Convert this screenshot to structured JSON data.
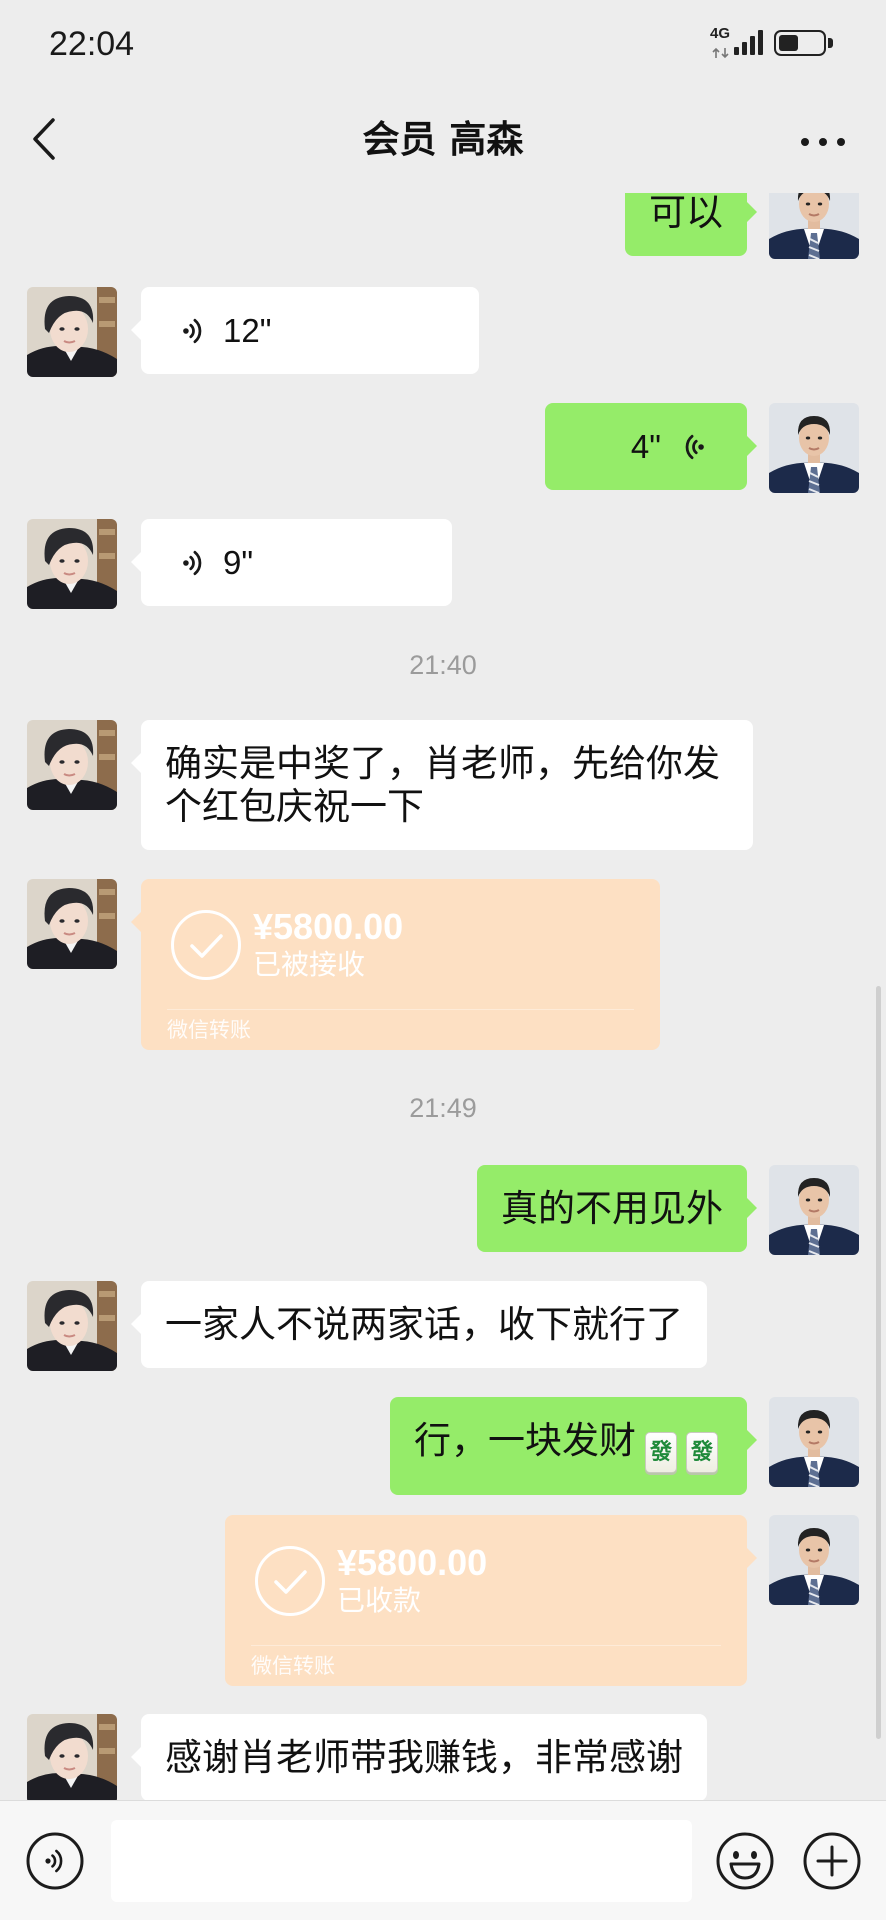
{
  "colors": {
    "background": "#ededed",
    "bubble_self": "#95ec69",
    "bubble_other": "#ffffff",
    "transfer_received": "#fde0c3",
    "timestamp_text": "#9b9b9b",
    "input_bar": "#f7f7f7"
  },
  "status_bar": {
    "time": "22:04",
    "network": "4G",
    "battery_level": 0.45,
    "signal_icon": "signal-bars-icon",
    "battery_icon": "battery-icon"
  },
  "header": {
    "title": "会员 高森",
    "back_icon": "chevron-left-icon",
    "more_icon": "more-dots-icon"
  },
  "messages": [
    {
      "outgoing": true,
      "text": "可以"
    },
    {
      "outgoing": false,
      "voice_duration": "12\"",
      "icon": "voice-icon"
    },
    {
      "outgoing": true,
      "voice_duration": "4\"",
      "icon": "voice-icon"
    },
    {
      "outgoing": false,
      "voice_duration": "9\"",
      "icon": "voice-icon"
    },
    {
      "timestamp": "21:40"
    },
    {
      "outgoing": false,
      "text": "确实是中奖了，肖老师，先给你发个红包庆祝一下"
    },
    {
      "outgoing": false,
      "transfer": {
        "amount": "¥5800.00",
        "status": "已被接收",
        "label": "微信转账",
        "icon": "check-circle-icon"
      }
    },
    {
      "timestamp": "21:49"
    },
    {
      "outgoing": true,
      "text": "真的不用见外"
    },
    {
      "outgoing": false,
      "text": "一家人不说两家话，收下就行了"
    },
    {
      "outgoing": true,
      "text": "行，一块发财",
      "emoji": [
        "發",
        "發"
      ]
    },
    {
      "outgoing": true,
      "transfer": {
        "amount": "¥5800.00",
        "status": "已收款",
        "label": "微信转账",
        "icon": "check-circle-icon"
      }
    },
    {
      "outgoing": false,
      "text": "感谢肖老师带我赚钱，非常感谢"
    }
  ],
  "input_bar": {
    "text": "",
    "voice_icon": "voice-mode-icon",
    "emoji_icon": "emoji-icon",
    "plus_icon": "plus-icon"
  }
}
